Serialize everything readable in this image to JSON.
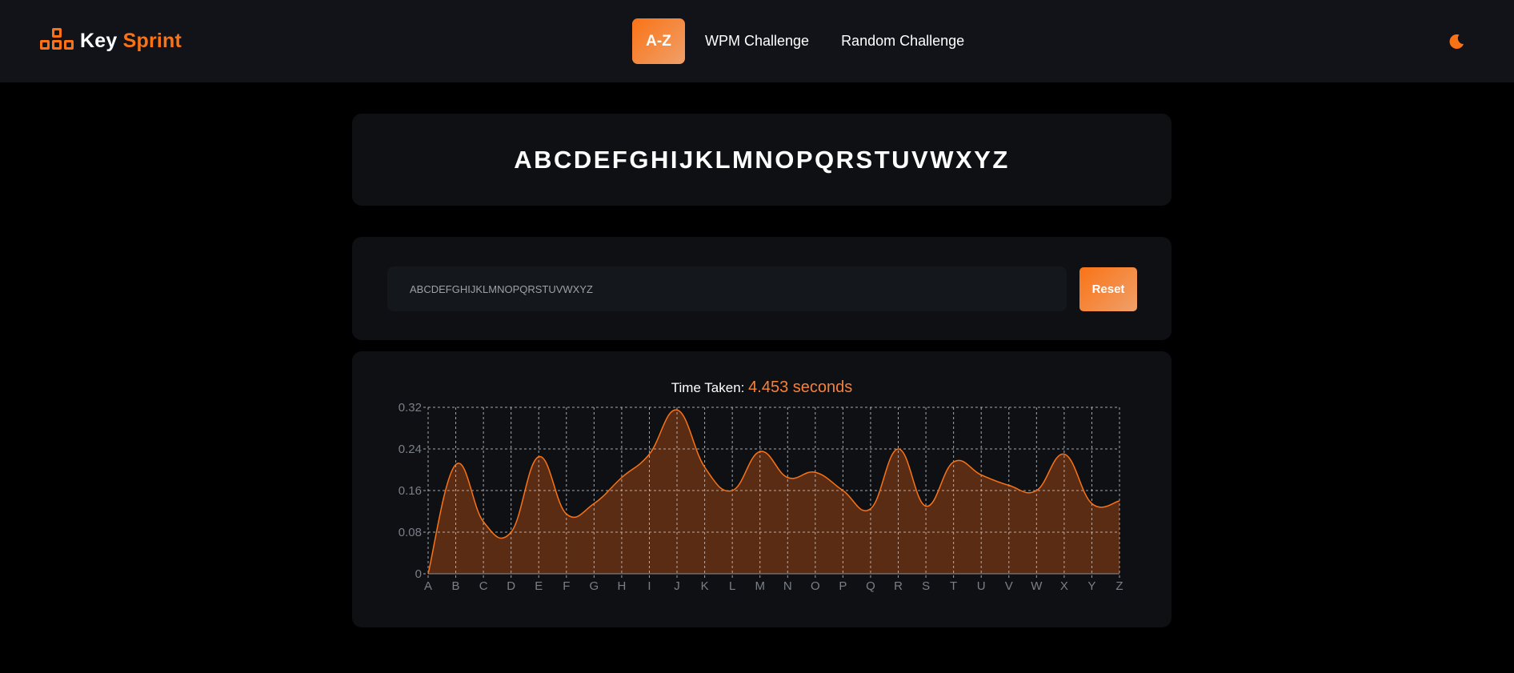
{
  "brand": {
    "key": "Key",
    "sprint": "Sprint",
    "logo_icon": "keyboard-keys-icon"
  },
  "nav": {
    "az": "A-Z",
    "wpm": "WPM Challenge",
    "random": "Random Challenge"
  },
  "theme_icon": "moon-icon",
  "colors": {
    "accent": "#f97316",
    "background": "#000000",
    "card": "#0e1014",
    "navbar": "#111318"
  },
  "target_text": "ABCDEFGHIJKLMNOPQRSTUVWXYZ",
  "input": {
    "value": "ABCDEFGHIJKLMNOPQRSTUVWXYZ"
  },
  "reset_label": "Reset",
  "time": {
    "label": "Time Taken:",
    "value": "4.453 seconds"
  },
  "chart_data": {
    "type": "area",
    "categories": [
      "A",
      "B",
      "C",
      "D",
      "E",
      "F",
      "G",
      "H",
      "I",
      "J",
      "K",
      "L",
      "M",
      "N",
      "O",
      "P",
      "Q",
      "R",
      "S",
      "T",
      "U",
      "V",
      "W",
      "X",
      "Y",
      "Z"
    ],
    "values": [
      0,
      0.21,
      0.1,
      0.08,
      0.225,
      0.115,
      0.135,
      0.185,
      0.23,
      0.315,
      0.205,
      0.16,
      0.235,
      0.185,
      0.195,
      0.16,
      0.125,
      0.24,
      0.13,
      0.215,
      0.19,
      0.17,
      0.16,
      0.23,
      0.135,
      0.14
    ],
    "yticks": [
      "0",
      "0.08",
      "0.16",
      "0.24",
      "0.32"
    ],
    "ylim": [
      0,
      0.32
    ],
    "grid": true,
    "line_color": "#f97316",
    "fill_color": "#5a2c14"
  }
}
